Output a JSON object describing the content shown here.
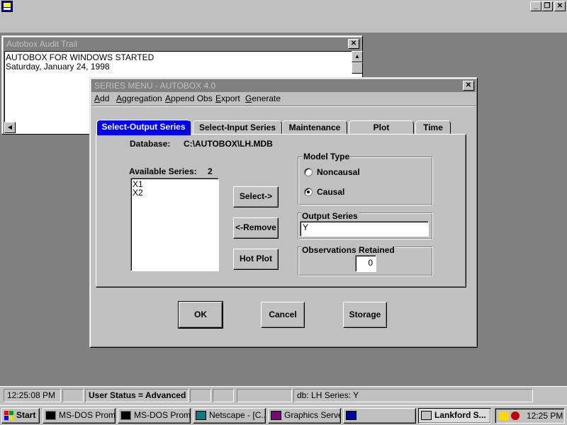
{
  "top_bar": {
    "buttons": {
      "minimize": "_",
      "restore": "❐",
      "close": "✕"
    }
  },
  "audit_trail": {
    "title": "Autobox Audit Trail",
    "lines": [
      "AUTOBOX FOR WINDOWS STARTED",
      "Saturday, January 24, 1998"
    ]
  },
  "series_menu": {
    "title": "SERIES MENU - AUTOBOX 4.0",
    "menu": [
      "Add",
      "Aggregation",
      "Append Obs",
      "Export",
      "Generate"
    ],
    "tabs": [
      "Select-Output Series",
      "Select-Input Series",
      "Maintenance",
      "Plot",
      "Time"
    ],
    "database_label": "Database:",
    "database_path": "C:\\AUTOBOX\\LH.MDB",
    "available_label": "Available Series:",
    "available_count": "2",
    "available_items": [
      "X1",
      "X2"
    ],
    "buttons": {
      "select": "Select->",
      "remove": "<-Remove",
      "hot_plot": "Hot Plot"
    },
    "model_type": {
      "label": "Model Type",
      "options": [
        "Noncausal",
        "Causal"
      ],
      "selected": "Causal"
    },
    "output_series": {
      "label": "Output Series",
      "value": "Y"
    },
    "observations": {
      "label": "Observations Retained",
      "value": "0"
    },
    "footer_buttons": {
      "ok": "OK",
      "cancel": "Cancel",
      "storage": "Storage"
    }
  },
  "status_bar": {
    "time": "12:25:08 PM",
    "user_status": "User Status = Advanced",
    "db_info": "db: LH Series: Y"
  },
  "taskbar": {
    "start": "Start",
    "tasks": [
      "MS-DOS Prompt",
      "MS-DOS Prompt",
      "Netscape - [C...",
      "Graphics Server",
      "",
      "Lankford S..."
    ],
    "clock": "12:25 PM"
  },
  "colors": {
    "accent": "#0000ff",
    "face": "#c0c0c0",
    "inactive_title": "#808080"
  }
}
